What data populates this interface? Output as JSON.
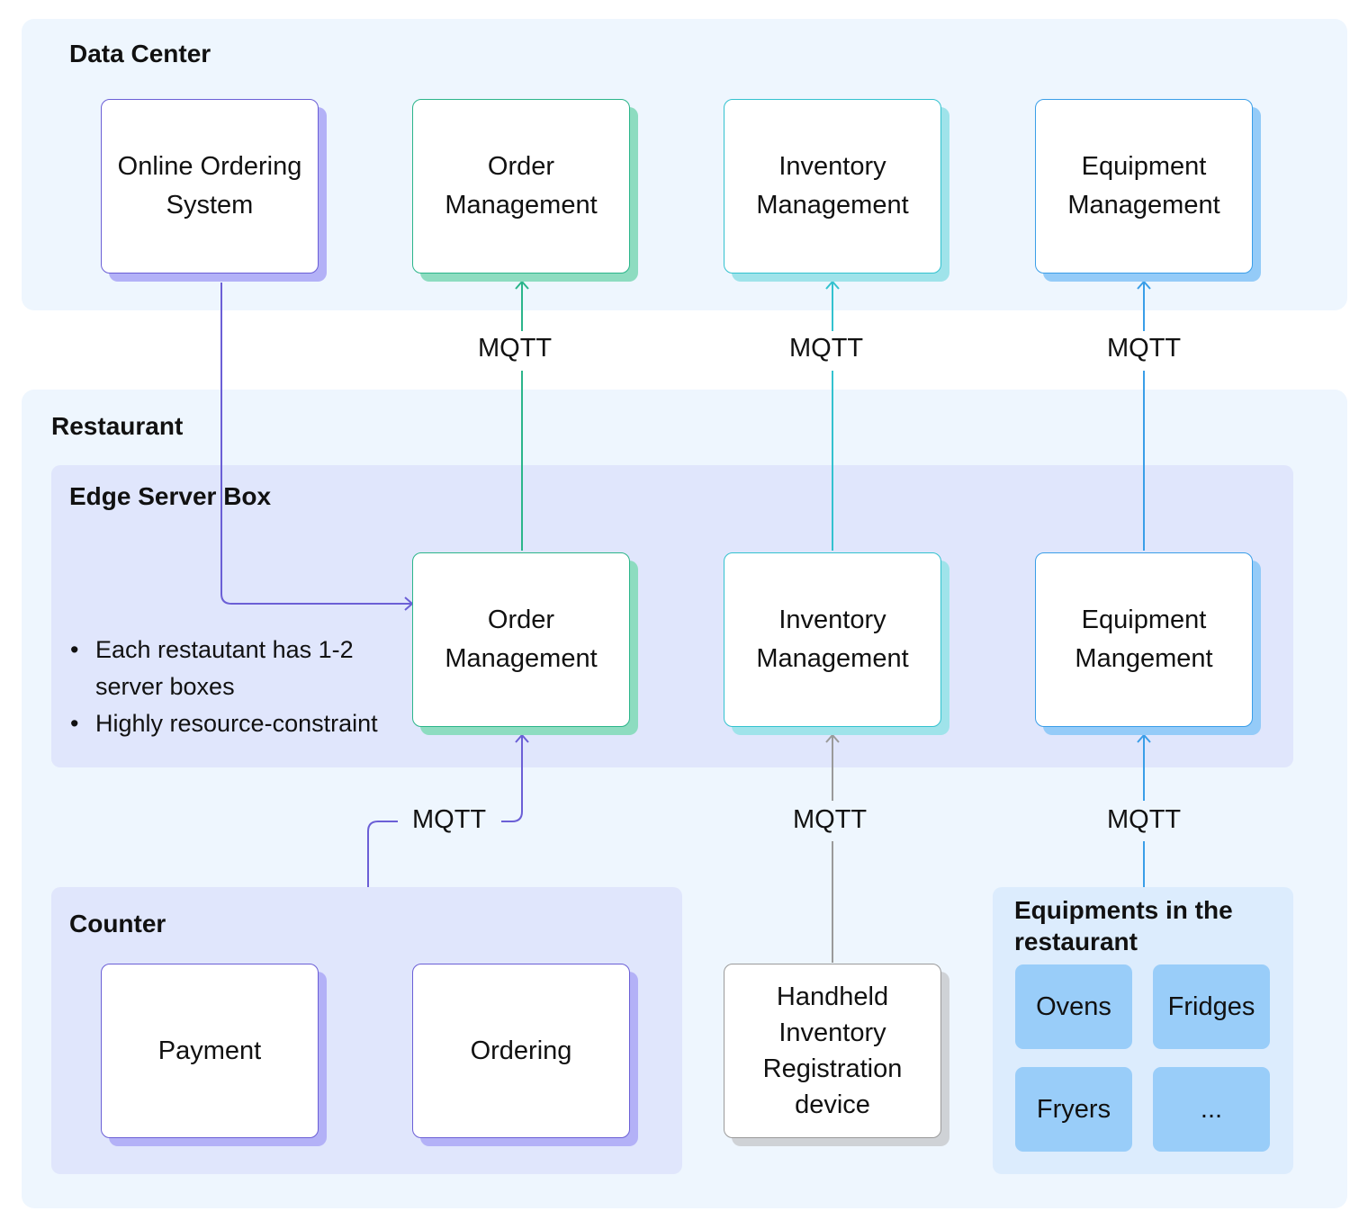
{
  "regions": {
    "data_center": "Data Center",
    "restaurant": "Restaurant",
    "edge_server_box": "Edge Server Box",
    "counter": "Counter",
    "equipments": "Equipments in the restaurant"
  },
  "data_center_nodes": [
    {
      "label": "Online Ordering System",
      "color": "#6b5fd6"
    },
    {
      "label": "Order Management",
      "color": "#2bb58a"
    },
    {
      "label": "Inventory Management",
      "color": "#33c2cf"
    },
    {
      "label": "Equipment Management",
      "color": "#3a9ee8"
    }
  ],
  "edge_nodes": [
    {
      "label": "Order Management",
      "color": "#2bb58a"
    },
    {
      "label": "Inventory Management",
      "color": "#33c2cf"
    },
    {
      "label": "Equipment Mangement",
      "color": "#3a9ee8"
    }
  ],
  "edge_notes": [
    "Each restautant has 1-2 server boxes",
    "Highly resource-constraint"
  ],
  "counter_nodes": [
    {
      "label": "Payment"
    },
    {
      "label": "Ordering"
    }
  ],
  "handheld_device": "Handheld Inventory Registration device",
  "equipment_items": [
    "Ovens",
    "Fridges",
    "Fryers",
    "..."
  ],
  "connections": [
    {
      "from": "Online Ordering System",
      "to": "Edge Order Management",
      "label": ""
    },
    {
      "from": "Edge Order Management",
      "to": "Data Center Order Management",
      "label": "MQTT"
    },
    {
      "from": "Edge Inventory Management",
      "to": "Data Center Inventory Management",
      "label": "MQTT"
    },
    {
      "from": "Edge Equipment Mangement",
      "to": "Data Center Equipment Management",
      "label": "MQTT"
    },
    {
      "from": "Counter",
      "to": "Edge Order Management",
      "label": "MQTT"
    },
    {
      "from": "Handheld Inventory Registration device",
      "to": "Edge Inventory Management",
      "label": "MQTT"
    },
    {
      "from": "Equipments in the restaurant",
      "to": "Edge Equipment Mangement",
      "label": "MQTT"
    }
  ],
  "connector_colors": {
    "purple": "#6b5fd6",
    "green": "#2bb58a",
    "teal": "#33c2cf",
    "blue": "#3a9ee8",
    "gray": "#9a9a9a"
  }
}
